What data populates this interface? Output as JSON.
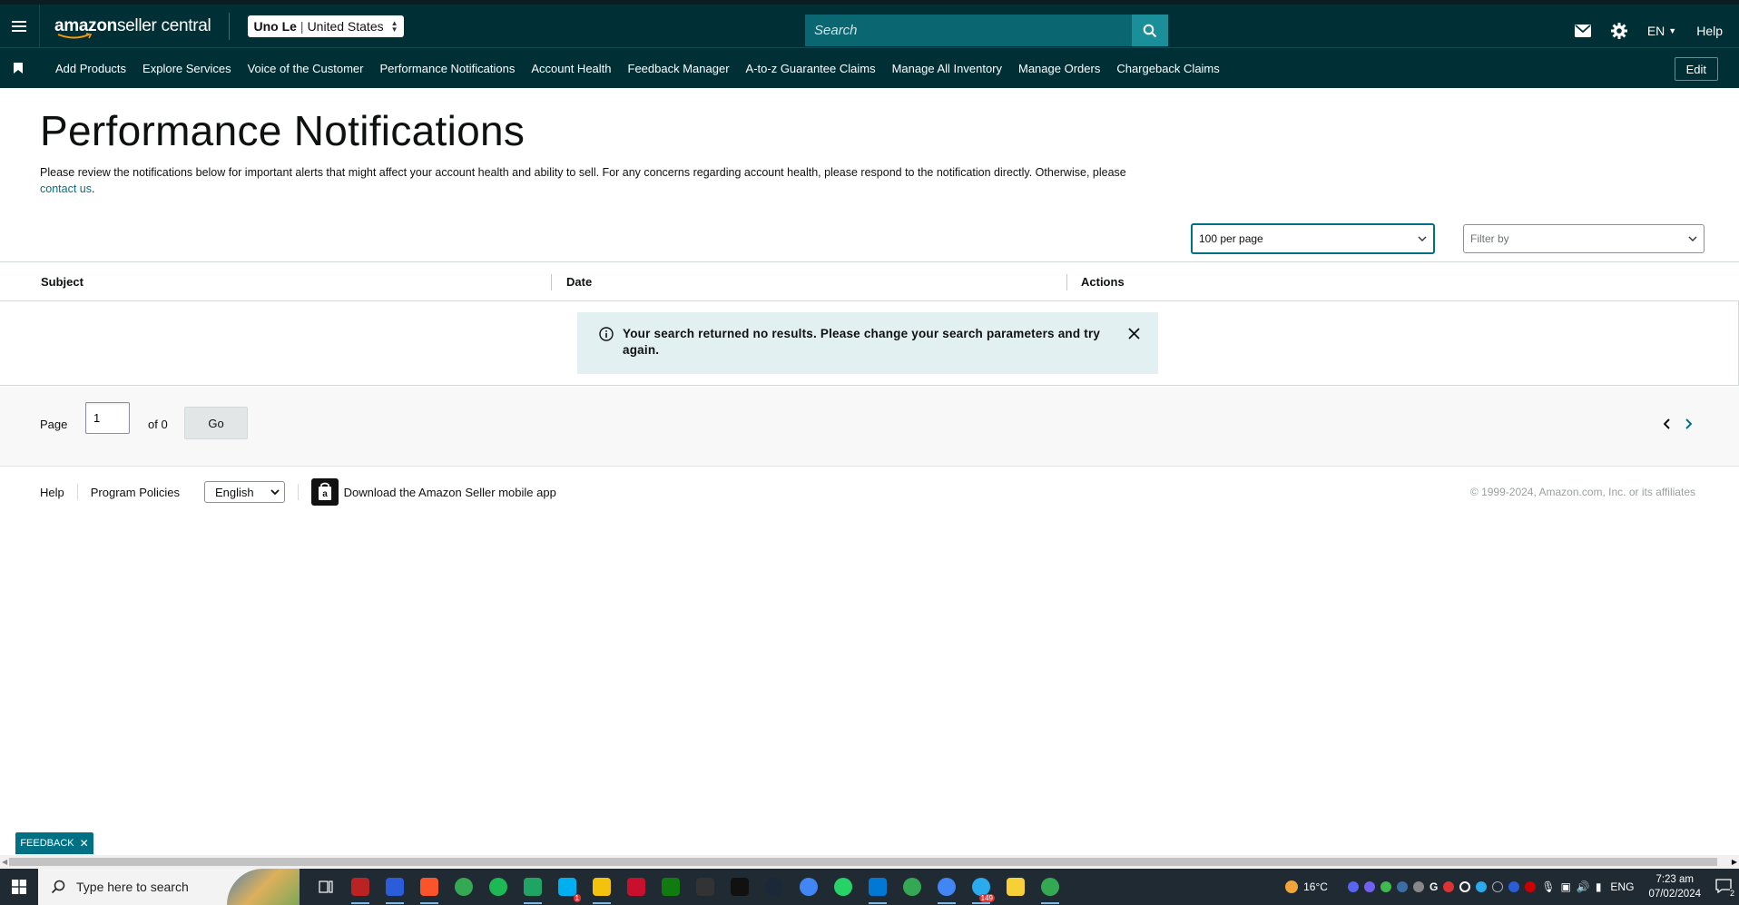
{
  "header": {
    "logo_text_bold": "amazon",
    "logo_text_rest": " seller central",
    "account_name": "Uno Le",
    "account_region": "United States",
    "search_placeholder": "Search",
    "lang": "EN",
    "help": "Help"
  },
  "nav": {
    "items": [
      "Add Products",
      "Explore Services",
      "Voice of the Customer",
      "Performance Notifications",
      "Account Health",
      "Feedback Manager",
      "A-to-z Guarantee Claims",
      "Manage All Inventory",
      "Manage Orders",
      "Chargeback Claims"
    ],
    "edit_label": "Edit"
  },
  "page": {
    "title": "Performance Notifications",
    "intro_text": "Please review the notifications below for important alerts that might affect your account health and ability to sell. For any concerns regarding account health, please respond to the notification directly. Otherwise, please ",
    "intro_link": "contact us",
    "intro_end": "."
  },
  "controls": {
    "per_page": "100 per page",
    "filter_placeholder": "Filter by"
  },
  "table": {
    "columns": [
      "Subject",
      "Date",
      "Actions"
    ],
    "empty_message": "Your search returned no results. Please change your search parameters and try again."
  },
  "pager": {
    "label": "Page",
    "current": "1",
    "of_text": "of 0",
    "go": "Go"
  },
  "footer": {
    "help": "Help",
    "policies": "Program Policies",
    "language": "English",
    "app_download": "Download the Amazon Seller mobile app",
    "copyright": "© 1999-2024, Amazon.com, Inc. or its affiliates"
  },
  "feedback_tab": "FEEDBACK",
  "taskbar": {
    "search_placeholder": "Type here to search",
    "weather": "16°C",
    "ime": "ENG",
    "time": "7:23 am",
    "date": "07/02/2024",
    "notification_count": "2",
    "telegram_badge": "149",
    "skype_badge": "1",
    "app_colors": [
      "#b22",
      "#2b5cd9",
      "#fb542b",
      "#34a853",
      "#1db954",
      "#1fa463",
      "#00aff0",
      "#f4c20d",
      "#c8102e",
      "#107c10",
      "#333",
      "#111",
      "#1b2838",
      "#4285f4",
      "#25d366",
      "#0078d4",
      "#34a853",
      "#4285f4",
      "#2aabee",
      "#f7d038",
      "#34a853"
    ]
  }
}
